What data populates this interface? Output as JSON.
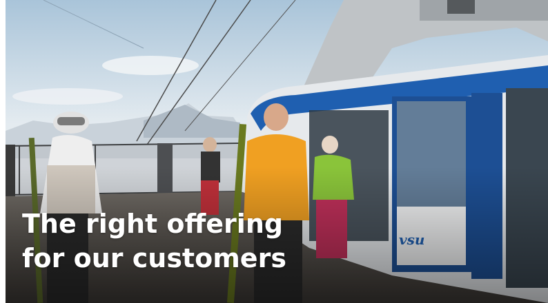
{
  "hero": {
    "headline_line1": "The right offering",
    "headline_line2": "for our customers",
    "cabin_logo_text": "vsu"
  },
  "colors": {
    "headline_text": "#ffffff",
    "cabin_blue": "#1f5fb0",
    "sky": "#dfe8ef"
  }
}
